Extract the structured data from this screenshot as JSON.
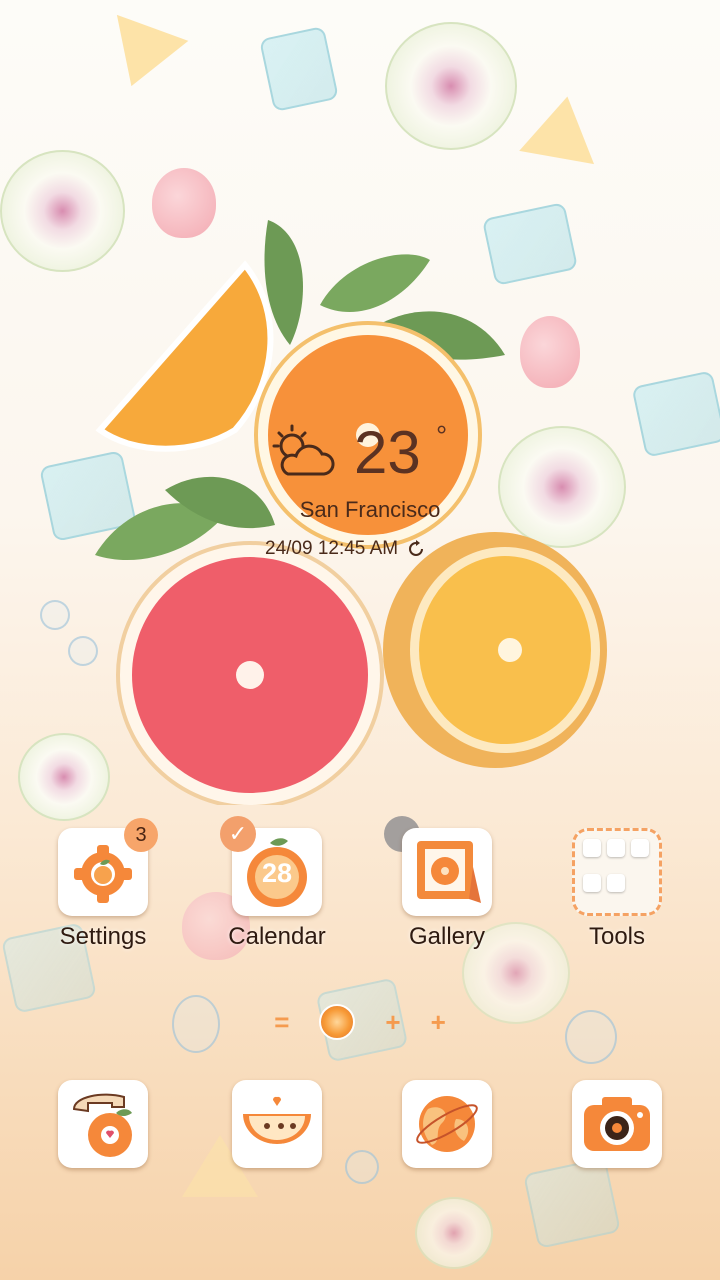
{
  "status": {},
  "weather_widget": {
    "icon": "partly-cloudy-icon",
    "temperature": "23",
    "degree_symbol": "°",
    "city": "San Francisco",
    "datetime": "24/09 12:45 AM",
    "refresh_icon": "refresh-icon"
  },
  "apps_row1": [
    {
      "label": "Settings",
      "icon": "gear-orange-icon",
      "badge": "3"
    },
    {
      "label": "Calendar",
      "icon": "orange-calendar-icon",
      "date": "28",
      "check": "✓"
    },
    {
      "label": "Gallery",
      "icon": "photo-frame-icon"
    },
    {
      "label": "Tools",
      "icon": "folder-icon"
    }
  ],
  "page_indicator": {
    "left": "=",
    "current": "orange-dot",
    "plus1": "+",
    "plus2": "+"
  },
  "dock": [
    {
      "icon": "phone-icon"
    },
    {
      "icon": "messages-icon"
    },
    {
      "icon": "browser-icon"
    },
    {
      "icon": "camera-icon"
    }
  ],
  "colors": {
    "accent": "#f59b4f",
    "text": "#2e1a10",
    "badge": "#f7a56a"
  }
}
